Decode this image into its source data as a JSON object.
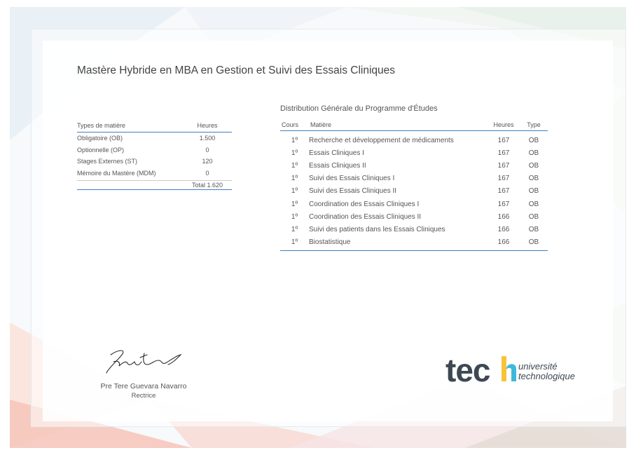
{
  "title": "Mastère Hybride en MBA en Gestion et Suivi des Essais Cliniques",
  "types_table": {
    "headers": [
      "Types de matière",
      "Heures"
    ],
    "rows": [
      {
        "label": "Obligatoire (OB)",
        "value": "1.500"
      },
      {
        "label": "Optionnelle (OP)",
        "value": "0"
      },
      {
        "label": "Stages Externes (ST)",
        "value": "120"
      },
      {
        "label": "Mémoire du Mastère (MDM)",
        "value": "0"
      }
    ],
    "total": "Total 1.620"
  },
  "distribution": {
    "title": "Distribution Générale du Programme d'Études",
    "headers": [
      "Cours",
      "Matière",
      "Heures",
      "Type"
    ],
    "rows": [
      {
        "cours": "1º",
        "matiere": "Recherche et développement de médicaments",
        "heures": "167",
        "type": "OB"
      },
      {
        "cours": "1º",
        "matiere": "Essais Cliniques I",
        "heures": "167",
        "type": "OB"
      },
      {
        "cours": "1º",
        "matiere": "Essais Cliniques II",
        "heures": "167",
        "type": "OB"
      },
      {
        "cours": "1º",
        "matiere": "Suivi des Essais Cliniques I",
        "heures": "167",
        "type": "OB"
      },
      {
        "cours": "1º",
        "matiere": "Suivi des Essais Cliniques II",
        "heures": "167",
        "type": "OB"
      },
      {
        "cours": "1º",
        "matiere": "Coordination des Essais Cliniques I",
        "heures": "167",
        "type": "OB"
      },
      {
        "cours": "1º",
        "matiere": "Coordination des Essais Cliniques II",
        "heures": "166",
        "type": "OB"
      },
      {
        "cours": "1º",
        "matiere": "Suivi des patients dans les Essais Cliniques",
        "heures": "166",
        "type": "OB"
      },
      {
        "cours": "1º",
        "matiere": "Biostatistique",
        "heures": "166",
        "type": "OB"
      }
    ]
  },
  "signature": {
    "name": "Pre Tere Guevara Navarro",
    "role": "Rectrice"
  },
  "logo": {
    "word": "tech",
    "tagline_1": "université",
    "tagline_2": "technologique"
  },
  "colors": {
    "accent_blue": "#3f7fc1",
    "logo_dark": "#3d4853",
    "logo_accent_1": "#f7c33a",
    "logo_accent_2": "#3fb8d9"
  }
}
